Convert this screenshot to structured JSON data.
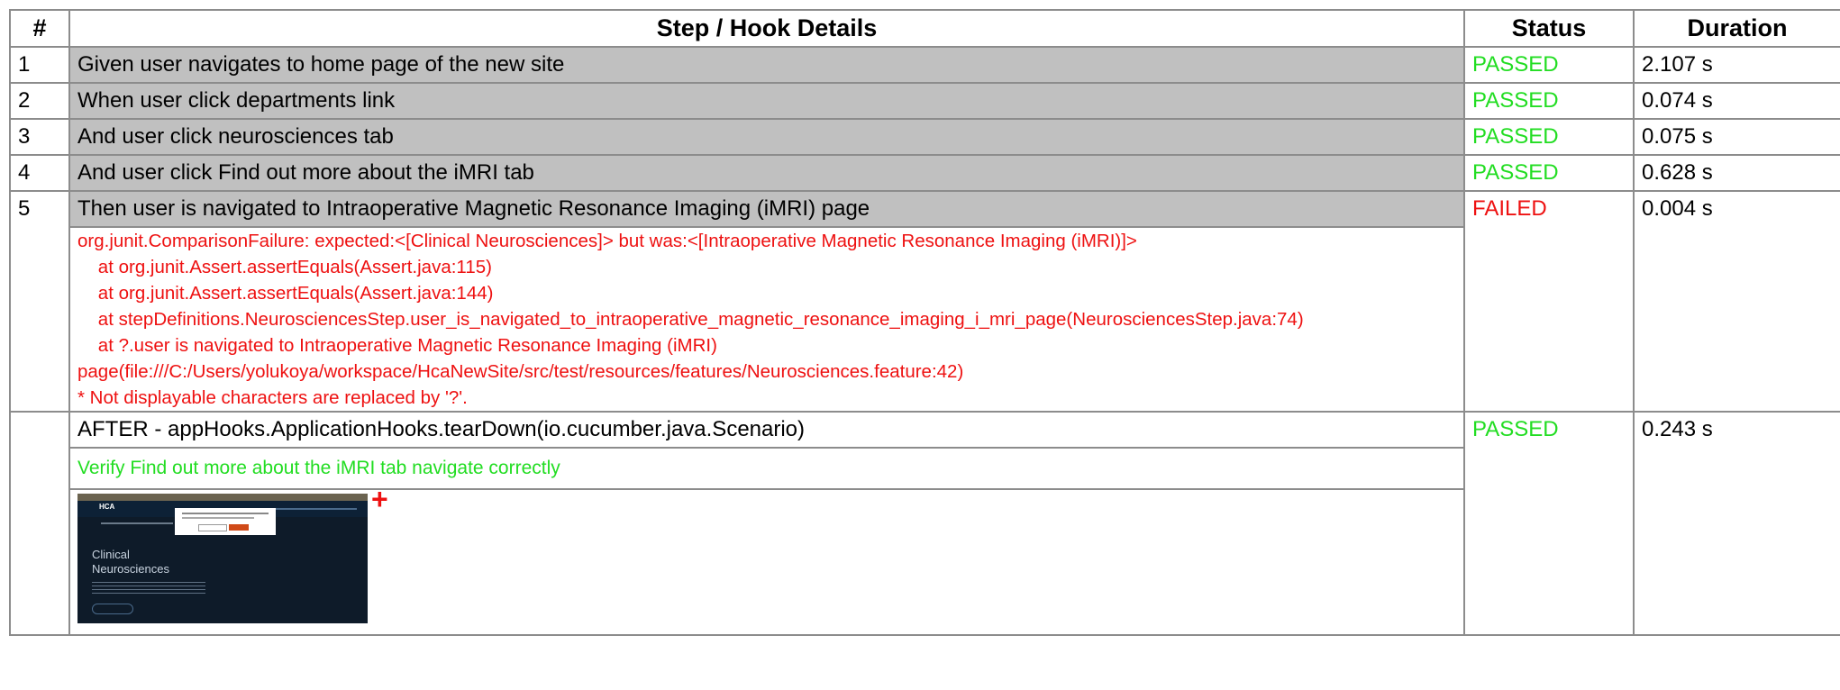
{
  "headers": {
    "num": "#",
    "details": "Step / Hook Details",
    "status": "Status",
    "duration": "Duration"
  },
  "steps": [
    {
      "num": "1",
      "text": "Given user navigates to home page of the new site",
      "status": "PASSED",
      "duration": "2.107 s"
    },
    {
      "num": "2",
      "text": "When user click departments link",
      "status": "PASSED",
      "duration": "0.074 s"
    },
    {
      "num": "3",
      "text": "And user click neurosciences tab",
      "status": "PASSED",
      "duration": "0.075 s"
    },
    {
      "num": "4",
      "text": "And user click Find out more about the iMRI tab",
      "status": "PASSED",
      "duration": "0.628 s"
    },
    {
      "num": "5",
      "text": "Then user is navigated to Intraoperative Magnetic Resonance Imaging (iMRI) page",
      "status": "FAILED",
      "duration": "0.004 s"
    }
  ],
  "error_lines": [
    "org.junit.ComparisonFailure: expected:<[Clinical Neurosciences]> but was:<[Intraoperative Magnetic Resonance Imaging (iMRI)]>",
    "    at org.junit.Assert.assertEquals(Assert.java:115)",
    "    at org.junit.Assert.assertEquals(Assert.java:144)",
    "    at stepDefinitions.NeurosciencesStep.user_is_navigated_to_intraoperative_magnetic_resonance_imaging_i_mri_page(NeurosciencesStep.java:74)",
    "    at ?.user is navigated to Intraoperative Magnetic Resonance Imaging (iMRI) page(file:///C:/Users/yolukoya/workspace/HcaNewSite/src/test/resources/features/Neurosciences.feature:42)",
    "* Not displayable characters are replaced by '?'."
  ],
  "hook": {
    "num": "",
    "text": "AFTER - appHooks.ApplicationHooks.tearDown(io.cucumber.java.Scenario)",
    "status": "PASSED",
    "duration": "0.243 s",
    "note": "Verify Find out more about the iMRI tab navigate  correctly",
    "screenshot": {
      "logo": "HCA",
      "heading_line1": "Clinical",
      "heading_line2": "Neurosciences",
      "expand_symbol": "+"
    }
  },
  "colors": {
    "passed": "#22dd22",
    "failed": "#ee1111",
    "step_bg": "#c0c0c0",
    "border": "#8c8c8c"
  }
}
